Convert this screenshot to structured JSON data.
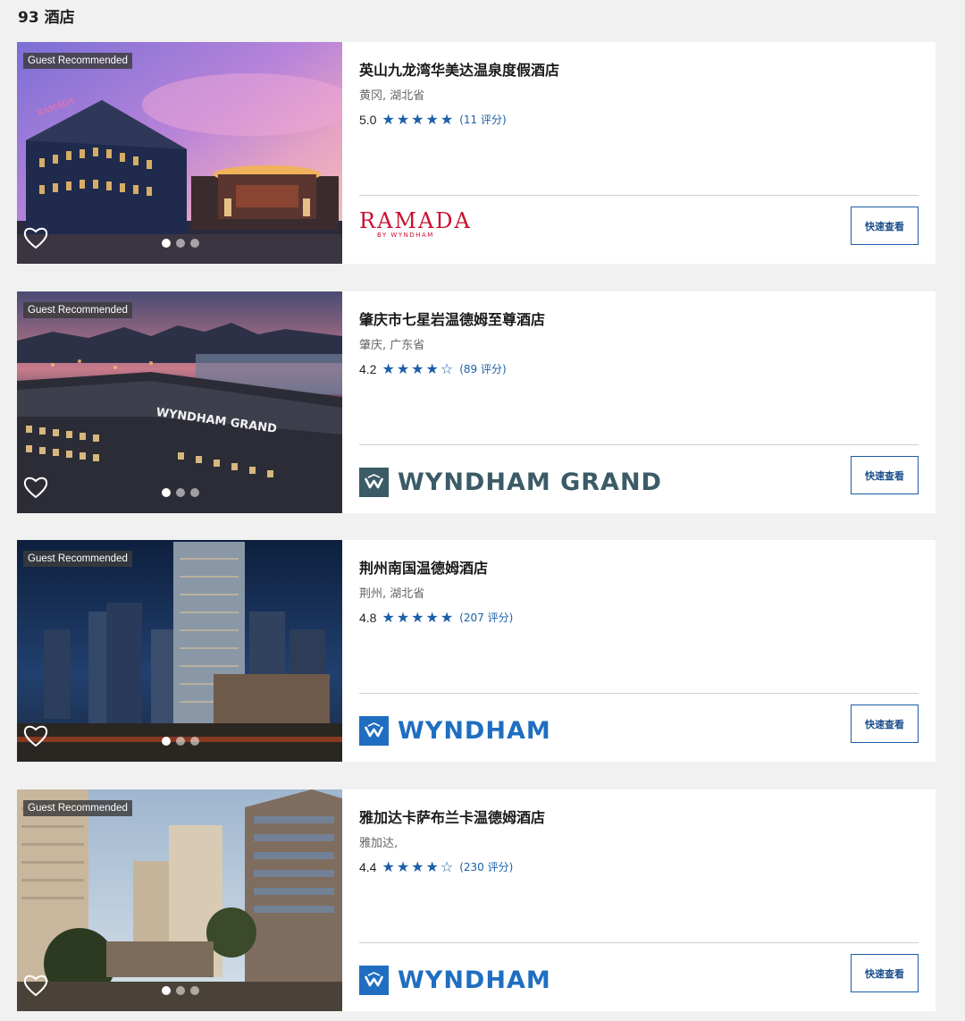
{
  "results": {
    "count_label": "93 酒店"
  },
  "colors": {
    "accent": "#1b5fa8",
    "ramada": "#c8102e",
    "grand": "#3b5b66",
    "wyndham": "#1f6ec1"
  },
  "hotels": [
    {
      "badge": "Guest Recommended",
      "name": "英山九龙湾华美达温泉度假酒店",
      "location": "黄冈, 湖北省",
      "score": "5.0",
      "stars": [
        "★",
        "★",
        "★",
        "★",
        "★"
      ],
      "reviews": "(11 评分)",
      "brand": "RAMADA",
      "brand_sub": "BY WYNDHAM",
      "button": "快速查看",
      "favorite_icon": "heart-icon"
    },
    {
      "badge": "Guest Recommended",
      "name": "肇庆市七星岩温德姆至尊酒店",
      "location": "肇庆, 广东省",
      "score": "4.2",
      "stars": [
        "★",
        "★",
        "★",
        "★",
        "☆"
      ],
      "reviews": "(89 评分)",
      "brand": "WYNDHAM GRAND",
      "photo_sign": "WYNDHAM GRAND",
      "button": "快速查看",
      "favorite_icon": "heart-icon"
    },
    {
      "badge": "Guest Recommended",
      "name": "荆州南国温德姆酒店",
      "location": "荆州, 湖北省",
      "score": "4.8",
      "stars": [
        "★",
        "★",
        "★",
        "★",
        "★"
      ],
      "reviews": "(207 评分)",
      "brand": "WYNDHAM",
      "button": "快速查看",
      "favorite_icon": "heart-icon"
    },
    {
      "badge": "Guest Recommended",
      "name": "雅加达卡萨布兰卡温德姆酒店",
      "location": "雅加达,",
      "score": "4.4",
      "stars": [
        "★",
        "★",
        "★",
        "★",
        "☆"
      ],
      "reviews": "(230 评分)",
      "brand": "WYNDHAM",
      "button": "快速查看",
      "favorite_icon": "heart-icon"
    }
  ]
}
